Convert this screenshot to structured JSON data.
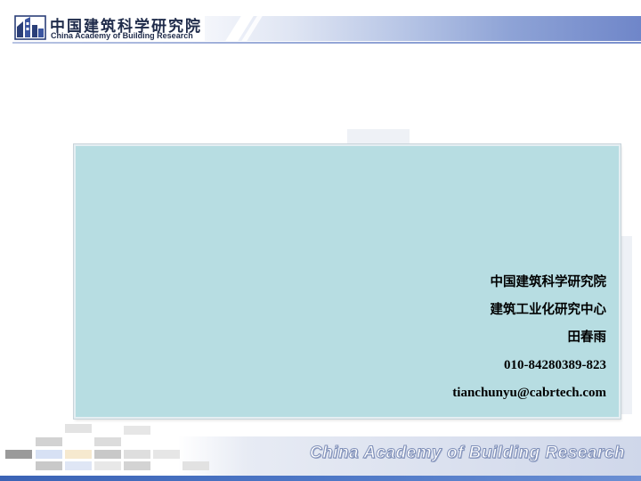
{
  "header": {
    "logo_cn": "中国建筑科学研究院",
    "logo_en": "China Academy of Building Research"
  },
  "contact": {
    "organization": "中国建筑科学研究院",
    "department": "建筑工业化研究中心",
    "name": "田春雨",
    "phone": "010-84280389-823",
    "email": "tianchunyu@cabrtech.com"
  },
  "footer": {
    "brand_text": "China Academy of Building Research"
  },
  "colors": {
    "panel_bg": "#b7dde2",
    "header_accent": "#6f86c9",
    "footer_bar": "#3b63b5"
  }
}
